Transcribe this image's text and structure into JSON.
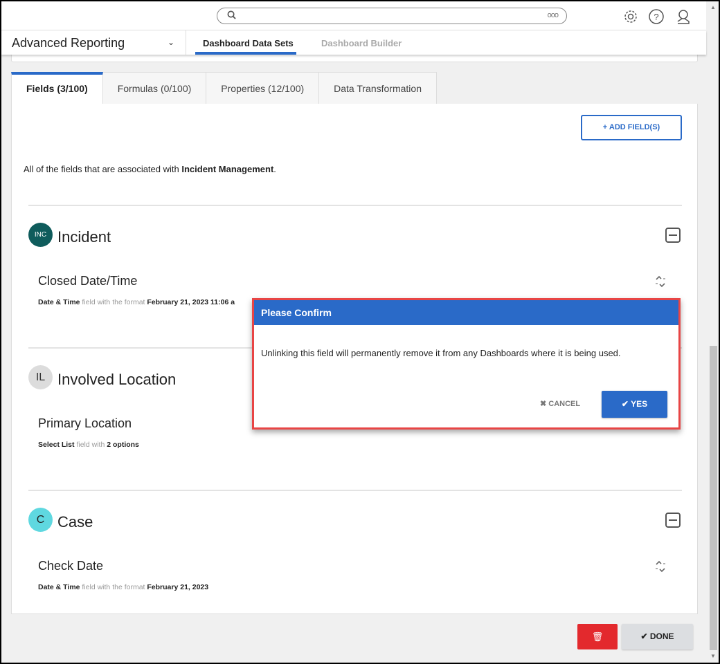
{
  "header": {
    "search_placeholder": "",
    "search_options": "ooo",
    "icons": [
      "gear-icon",
      "help-icon",
      "user-icon"
    ]
  },
  "subnav": {
    "app_title": "Advanced Reporting",
    "tabs": [
      {
        "label": "Dashboard Data Sets",
        "active": true
      },
      {
        "label": "Dashboard Builder",
        "active": false
      }
    ]
  },
  "tabs": [
    {
      "label": "Fields (3/100)",
      "active": true
    },
    {
      "label": "Formulas (0/100)"
    },
    {
      "label": "Properties (12/100)"
    },
    {
      "label": "Data Transformation"
    }
  ],
  "panel": {
    "add_button": "ADD FIELD(S)",
    "desc_prefix": "All of the fields that are associated with ",
    "desc_bold": "Incident Management",
    "desc_suffix": ".",
    "sections": [
      {
        "avatar": "INC",
        "avatar_color": "#0f5c5c",
        "title": "Incident",
        "field": {
          "name": "Closed Date/Time",
          "type": "Date & Time",
          "mid": "field with the format",
          "value": "February 21, 2023 11:06 a"
        }
      },
      {
        "avatar": "IL",
        "avatar_color": "#dcdcdc",
        "title": "Involved Location",
        "field": {
          "name": "Primary Location",
          "type": "Select List",
          "mid": "field with",
          "value": "2 options"
        }
      },
      {
        "avatar": "C",
        "avatar_color": "#5fd8e0",
        "title": "Case",
        "field": {
          "name": "Check Date",
          "type": "Date & Time",
          "mid": "field with the format",
          "value": "February 21, 2023"
        }
      }
    ]
  },
  "modal": {
    "title": "Please Confirm",
    "message": "Unlinking this field will permanently remove it from any Dashboards where it is being used.",
    "cancel": "CANCEL",
    "yes": "YES"
  },
  "footer": {
    "done": "DONE"
  },
  "colors": {
    "accent": "#2a6ac8",
    "danger": "#e3292d",
    "highlight": "#e84545"
  }
}
